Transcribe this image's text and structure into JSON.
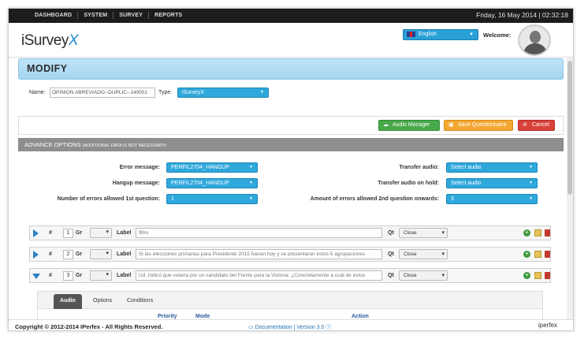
{
  "topnav": [
    "DASHBOARD",
    "SYSTEM",
    "SURVEY",
    "REPORTS"
  ],
  "datetime": "Friday, 16 May 2014 | 02:32:18",
  "logo": {
    "prefix": "iSurvey",
    "suffix": "X"
  },
  "language": "English",
  "welcome": "Welcome:",
  "page_title": "MODIFY",
  "name_label": "Name:",
  "name_value": "OPINION ABREVIADO--DUPLIC--140001",
  "type_label": "Type:",
  "type_value": "iSurveyX",
  "buttons": {
    "audio_manager": "Audio Manager",
    "save": "Save Questionnaire",
    "cancel": "Cancel"
  },
  "advance": {
    "title": "ADVANCE OPTIONS",
    "note": "(ADDITIONAL DATA IS NOT NECESSARY)"
  },
  "form": {
    "error_message_label": "Error message:",
    "error_message_value": "PERFIL2704_HANGUP",
    "hangup_message_label": "Hangup message:",
    "hangup_message_value": "PERFIL2704_HANGUP",
    "errors_first_label": "Number of errors allowed 1st question:",
    "errors_first_value": "1",
    "transfer_audio_label": "Transfer audio:",
    "transfer_audio_value": "Select audio",
    "transfer_hold_label": "Transfer audio on hold:",
    "transfer_hold_value": "Select audio",
    "errors_second_label": "Amount of errors allowed 2nd question onwards:",
    "errors_second_value": "3"
  },
  "question_labels": {
    "hash": "#",
    "gr": "Gr",
    "label": "Label",
    "qt": "Qt"
  },
  "questions": [
    {
      "number": "1",
      "label": "filtro",
      "qt": "Close"
    },
    {
      "number": "2",
      "label": "Si las elecciones primarias para Presidente 2015 fueran hoy y se presentaran estos 5 agrupaciones",
      "qt": "Close"
    },
    {
      "number": "3",
      "label": "Ud. indicó que votaría por un candidato del Frente para la Victoria: ¿Concretamente a cuál de estos",
      "qt": "Close"
    }
  ],
  "tabs": [
    "Audio",
    "Options",
    "Conditions"
  ],
  "columns": {
    "priority": "Priority",
    "mode": "Mode",
    "action": "Action"
  },
  "footer": {
    "copyright": "Copyright © 2012-2014 IPerfex - All Rights Reserved.",
    "documentation": "Documentation",
    "version": "Version 3.0",
    "brand": "iperfex"
  }
}
